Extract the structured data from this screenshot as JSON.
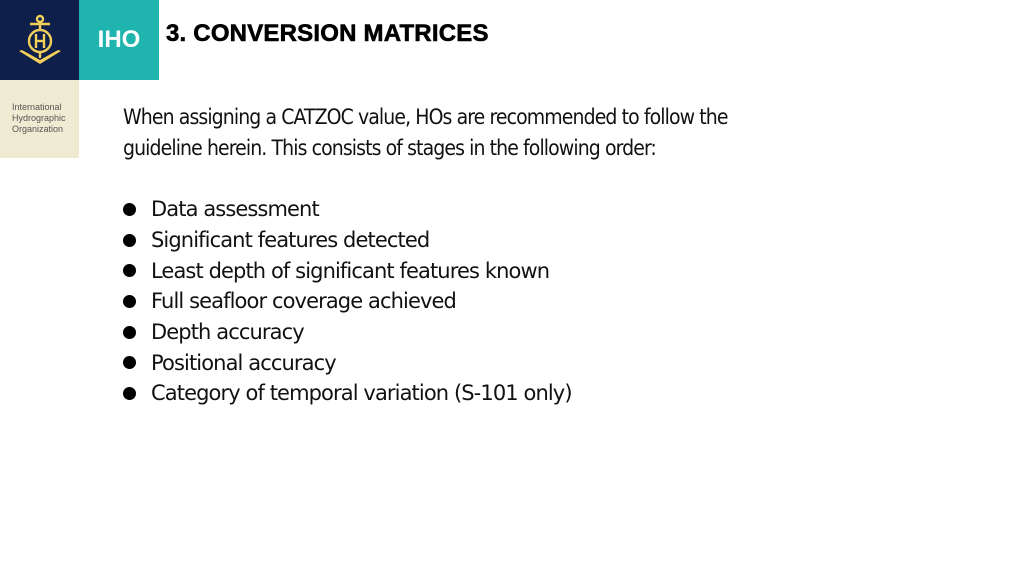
{
  "logo": {
    "emblem": "iho-anchor-emblem-icon",
    "abbreviation": "IHO",
    "organization_name": "International\nHydrographic\nOrganization",
    "colors": {
      "navy": "#0f1f4b",
      "teal": "#1fb5ae",
      "gold": "#f2cf5a",
      "beige": "#efebd2"
    }
  },
  "slide": {
    "title": "3. CONVERSION MATRICES",
    "intro_lines": [
      "When assigning a CATZOC value, HOs are recommended to follow the",
      "guideline herein. This consists of stages in the following order:"
    ],
    "stages": [
      "Data assessment",
      "Significant features detected",
      "Least depth of significant features known",
      "Full seafloor coverage achieved",
      "Depth accuracy",
      "Positional accuracy",
      "Category of temporal variation (S-101 only)"
    ]
  }
}
